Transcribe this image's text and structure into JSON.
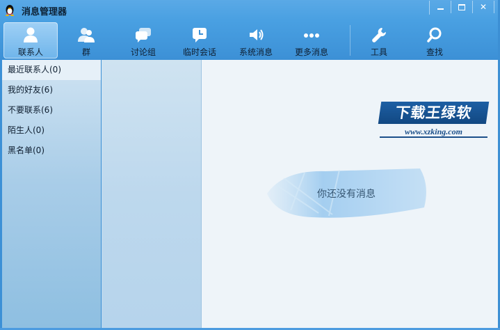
{
  "window": {
    "title": "消息管理器"
  },
  "toolbar": {
    "items": [
      {
        "label": "联系人",
        "icon": "person-icon",
        "active": true
      },
      {
        "label": "群",
        "icon": "group-icon"
      },
      {
        "label": "讨论组",
        "icon": "chat-bubbles-icon"
      },
      {
        "label": "临时会话",
        "icon": "clock-bubble-icon"
      },
      {
        "label": "系统消息",
        "icon": "speaker-icon"
      },
      {
        "label": "更多消息",
        "icon": "more-dots-icon"
      },
      {
        "label": "工具",
        "icon": "wrench-icon"
      },
      {
        "label": "查找",
        "icon": "magnifier-icon"
      }
    ]
  },
  "sidebar": {
    "items": [
      {
        "label": "最近联系人(0)",
        "active": true
      },
      {
        "label": "我的好友(6)"
      },
      {
        "label": "不要联系(6)"
      },
      {
        "label": "陌生人(0)"
      },
      {
        "label": "黑名单(0)"
      }
    ]
  },
  "main": {
    "empty_message": "你还没有消息",
    "watermark_title": "下载王绿软",
    "watermark_url": "www.xzking.com"
  },
  "colors": {
    "accent": "#3c90d6",
    "active_tab": "#8ec6f0",
    "main_bg": "#eef4f9"
  }
}
